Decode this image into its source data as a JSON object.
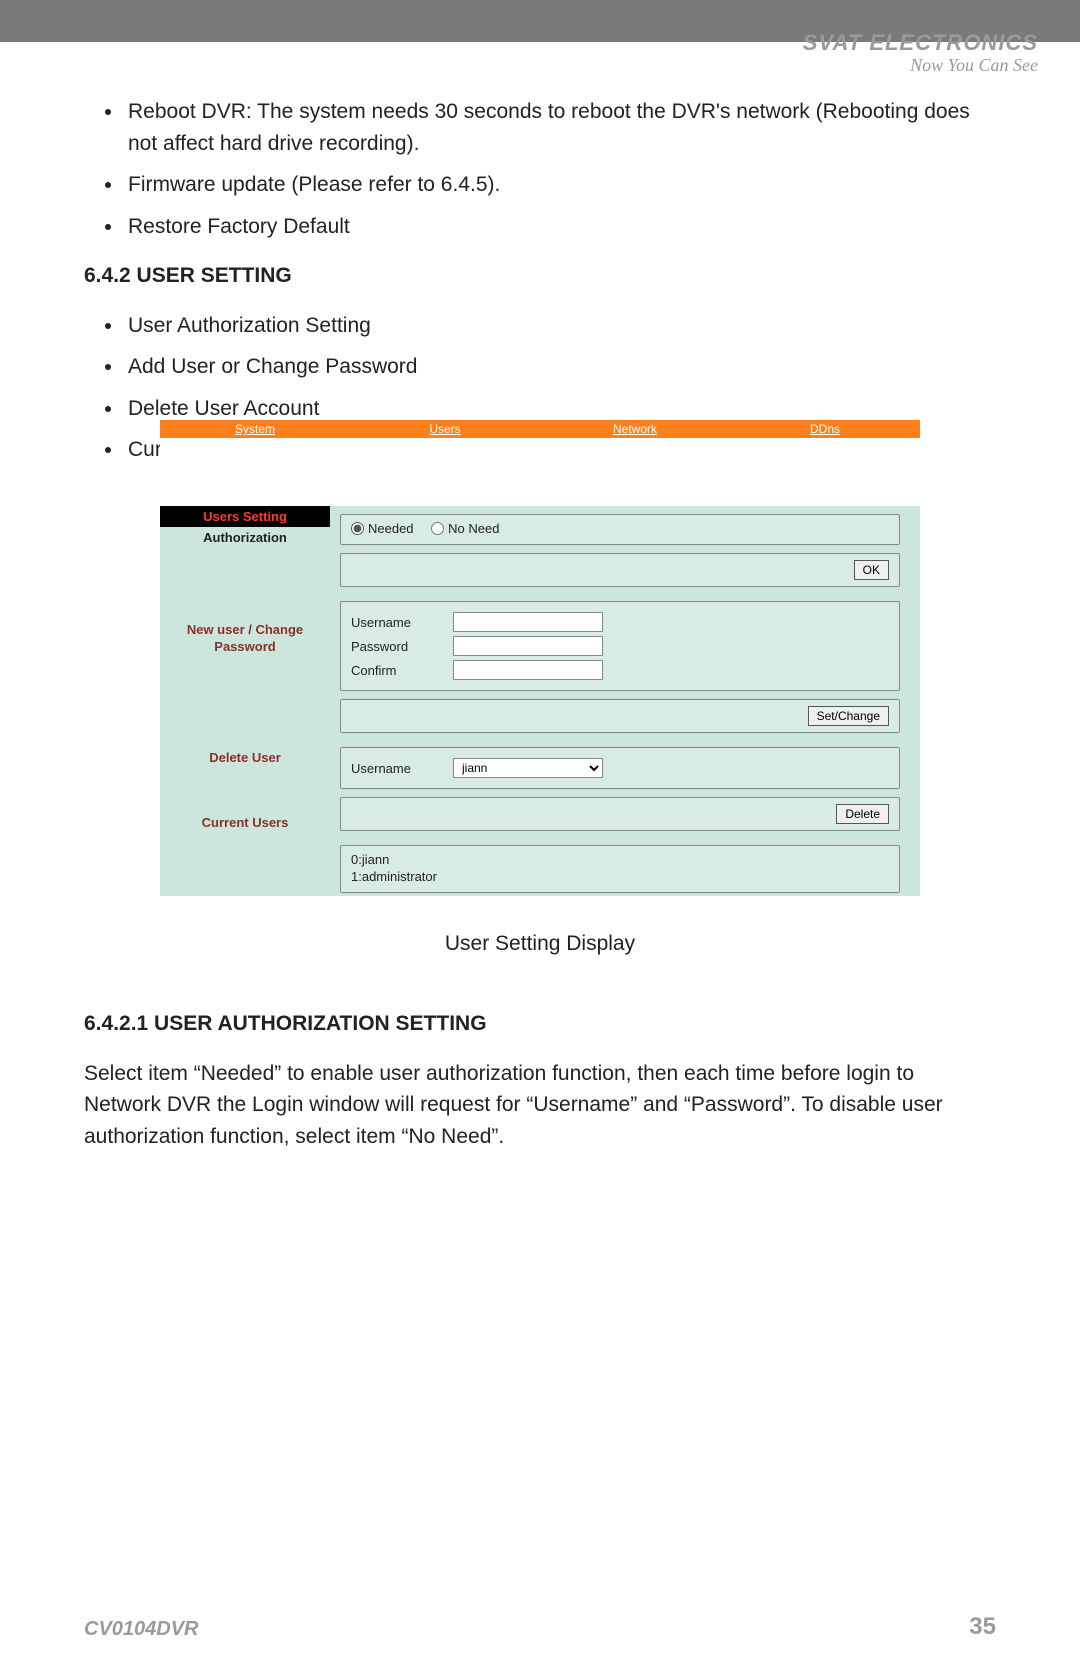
{
  "header": {
    "brand": "SVAT ELECTRONICS",
    "tagline": "Now You Can See"
  },
  "intro_bullets": [
    "Reboot DVR: The system needs 30 seconds to reboot the DVR's network (Rebooting does not affect hard drive recording).",
    "Firmware update (Please refer to 6.4.5).",
    "Restore Factory Default"
  ],
  "section_642": {
    "heading": "6.4.2 USER SETTING",
    "bullets": [
      "User Authorization Setting",
      "Add User or Change Password",
      "Delete User Account",
      "Current Users"
    ]
  },
  "ui": {
    "tabs": [
      "System",
      "Users",
      "Network",
      "DDns"
    ],
    "side": {
      "header": "Users Setting",
      "authorization": "Authorization",
      "newuser": "New user / Change Password",
      "deleteuser": "Delete User",
      "currentusers": "Current Users"
    },
    "auth": {
      "needed": "Needed",
      "noneed": "No Need",
      "ok": "OK"
    },
    "newuser": {
      "username_label": "Username",
      "password_label": "Password",
      "confirm_label": "Confirm",
      "setchange": "Set/Change"
    },
    "deleteuser": {
      "username_label": "Username",
      "selected": "jiann",
      "delete": "Delete"
    },
    "currentusers": {
      "line0": "0:jiann",
      "line1": "1:administrator"
    }
  },
  "figure_caption": "User Setting Display",
  "section_6421": {
    "heading": "6.4.2.1 USER AUTHORIZATION SETTING",
    "body": "Select item “Needed” to enable user authorization function, then each time before login to Network DVR the Login window will request for “Username” and “Password”. To disable user authorization function, select item “No Need”."
  },
  "footer": {
    "model": "CV0104DVR",
    "page": "35"
  }
}
